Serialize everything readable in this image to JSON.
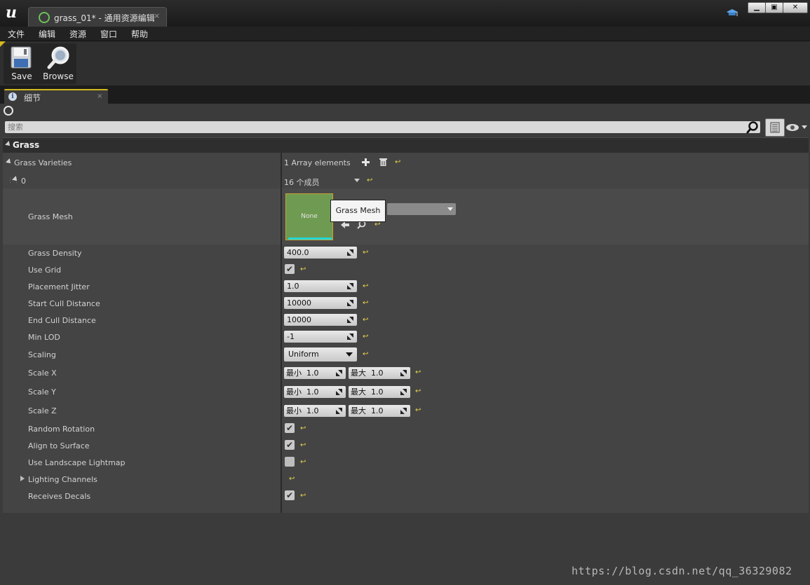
{
  "window": {
    "tab_title": "grass_01* - 通用资源编辑",
    "tab_close": "×",
    "min_label": "▁",
    "max_label": "▣",
    "close_label": "✕"
  },
  "menu": [
    "文件",
    "编辑",
    "资源",
    "窗口",
    "帮助"
  ],
  "toolbar": {
    "save_label": "Save",
    "browse_label": "Browse"
  },
  "panel": {
    "tab_label": "细节",
    "tab_close": "×",
    "tab_icon": "i",
    "search_placeholder": "搜索"
  },
  "category": {
    "label": "Grass"
  },
  "array": {
    "label": "Grass Varieties",
    "summary": "1 Array elements",
    "element_index": "0",
    "element_summary": "16 个成员"
  },
  "grass_mesh": {
    "label": "Grass Mesh",
    "thumb_text": "None",
    "tooltip": "Grass Mesh"
  },
  "properties": {
    "grass_density": {
      "label": "Grass Density",
      "value": "400.0"
    },
    "use_grid": {
      "label": "Use Grid",
      "checked": true
    },
    "placement_jitter": {
      "label": "Placement Jitter",
      "value": "1.0"
    },
    "start_cull": {
      "label": "Start Cull Distance",
      "value": "10000"
    },
    "end_cull": {
      "label": "End Cull Distance",
      "value": "10000"
    },
    "min_lod": {
      "label": "Min LOD",
      "value": "-1"
    },
    "scaling": {
      "label": "Scaling",
      "value": "Uniform"
    },
    "scale_x": {
      "label": "Scale X",
      "min_prefix": "最小",
      "min": "1.0",
      "max_prefix": "最大",
      "max": "1.0"
    },
    "scale_y": {
      "label": "Scale Y",
      "min_prefix": "最小",
      "min": "1.0",
      "max_prefix": "最大",
      "max": "1.0"
    },
    "scale_z": {
      "label": "Scale Z",
      "min_prefix": "最小",
      "min": "1.0",
      "max_prefix": "最大",
      "max": "1.0"
    },
    "random_rotation": {
      "label": "Random Rotation",
      "checked": true
    },
    "align_to_surface": {
      "label": "Align to Surface",
      "checked": true
    },
    "use_landscape_lightmap": {
      "label": "Use Landscape Lightmap",
      "checked": false
    },
    "lighting_channels": {
      "label": "Lighting Channels"
    },
    "receives_decals": {
      "label": "Receives Decals",
      "checked": true
    }
  },
  "check_glyph": "✔",
  "reset_glyph": "↩",
  "watermark": "https://blog.csdn.net/qq_36329082",
  "colors": {
    "accent": "#d3b81f",
    "reset": "#e9d64a",
    "thumb": "#6f9a52"
  }
}
